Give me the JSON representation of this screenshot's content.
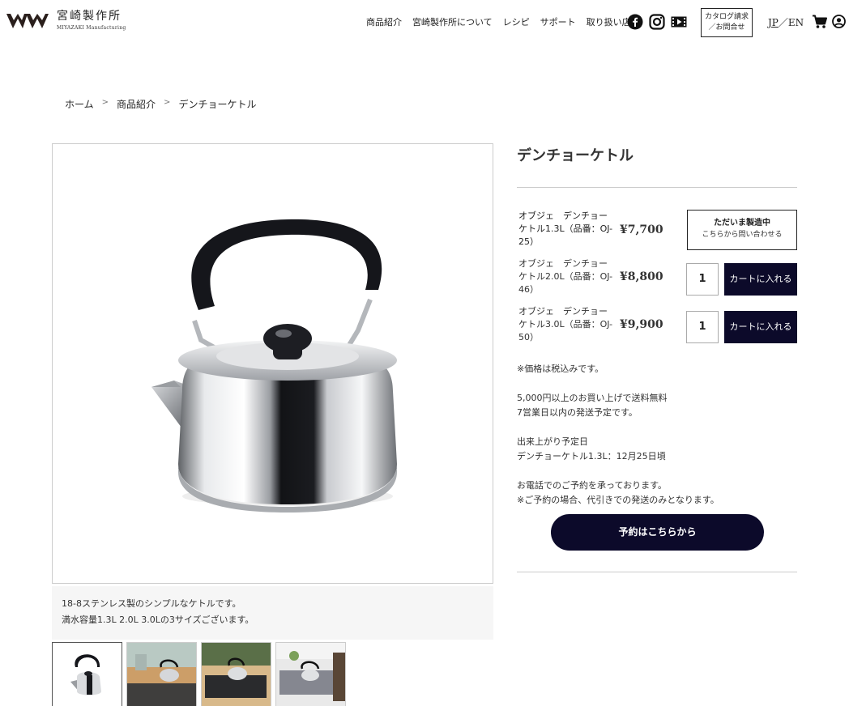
{
  "header": {
    "logo_jp": "宮崎製作所",
    "logo_en": "MIYAZAKI Manufacturing",
    "nav": [
      "商品紹介",
      "宮崎製作所について",
      "レシピ",
      "サポート",
      "取り扱い店舗"
    ],
    "social_icons": [
      "facebook-icon",
      "instagram-icon",
      "youtube-icon"
    ],
    "catalog_line1": "カタログ請求",
    "catalog_line2": "／お問合せ",
    "lang_jp": "JP",
    "lang_sep": "／",
    "lang_en": "EN"
  },
  "breadcrumb": {
    "home": "ホーム",
    "sep": ">",
    "category": "商品紹介",
    "current": "デンチョーケトル"
  },
  "product": {
    "title": "デンチョーケトル",
    "description_line1": "18-8ステンレス製のシンプルなケトルです。",
    "description_line2": "満水容量1.3L 2.0L 3.0Lの3サイズございます。"
  },
  "variants": [
    {
      "name": "オブジェ　デンチョーケトル1.3L（品番：OJ-25）",
      "price": "¥7,700",
      "status_line1": "ただいま製造中",
      "status_line2": "こちらから問い合わせる"
    },
    {
      "name": "オブジェ　デンチョーケトル2.0L（品番：OJ-46）",
      "price": "¥8,800",
      "qty": "1",
      "cart_label": "カートに入れる"
    },
    {
      "name": "オブジェ　デンチョーケトル3.0L（品番：OJ-50）",
      "price": "¥9,900",
      "qty": "1",
      "cart_label": "カートに入れる"
    }
  ],
  "info": {
    "tax_note": "※価格は税込みです。",
    "shipping_line1": "5,000円以上のお買い上げで送料無料",
    "shipping_line2": "7営業日以内の発送予定です。",
    "complete_label": "出来上がり予定日",
    "complete_value": "デンチョーケトル1.3L：12月25日頃",
    "phone_line1": "お電話でのご予約を承っております。",
    "phone_line2": "※ご予約の場合、代引きでの発送のみとなります。"
  },
  "reserve_button": "予約はこちらから",
  "colors": {
    "navy": "#0c0a2a",
    "border": "#cccccc",
    "desc_bg": "#f6f6f6"
  }
}
